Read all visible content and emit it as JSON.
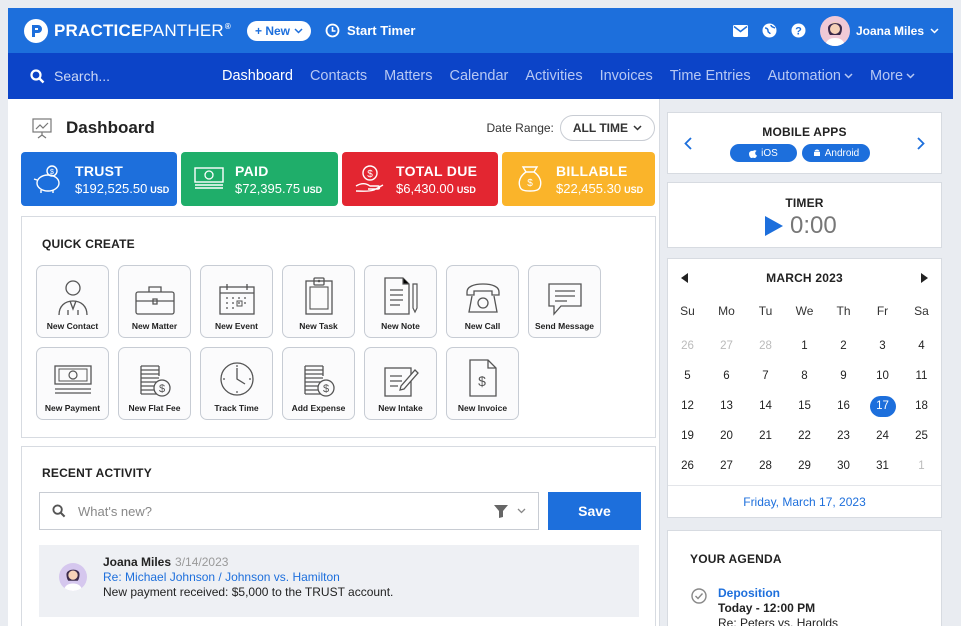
{
  "brand": {
    "name_bold": "PRACTICE",
    "name_thin": "PANTHER",
    "reg": "®"
  },
  "header": {
    "new_button": "+ New",
    "start_timer": "Start Timer",
    "user_name": "Joana Miles",
    "icons": [
      "mail-icon",
      "globe-icon",
      "help-icon",
      "avatar"
    ]
  },
  "nav": {
    "search_placeholder": "Search...",
    "items": [
      {
        "label": "Dashboard",
        "active": true
      },
      {
        "label": "Contacts"
      },
      {
        "label": "Matters"
      },
      {
        "label": "Calendar"
      },
      {
        "label": "Activities"
      },
      {
        "label": "Invoices"
      },
      {
        "label": "Time Entries"
      },
      {
        "label": "Automation",
        "dropdown": true
      },
      {
        "label": "More",
        "dropdown": true
      }
    ]
  },
  "dashboard": {
    "title": "Dashboard",
    "date_range_label": "Date Range:",
    "date_range_value": "ALL TIME"
  },
  "stats": [
    {
      "label": "TRUST",
      "value": "$192,525.50",
      "currency": "USD",
      "color": "#1d6fdc"
    },
    {
      "label": "PAID",
      "value": "$72,395.75",
      "currency": "USD",
      "color": "#1fae6a"
    },
    {
      "label": "TOTAL DUE",
      "value": "$6,430.00",
      "currency": "USD",
      "color": "#e32631"
    },
    {
      "label": "BILLABLE",
      "value": "$22,455.30",
      "currency": "USD",
      "color": "#fab42a"
    }
  ],
  "quick_create": {
    "title": "QUICK CREATE",
    "items": [
      {
        "label": "New Contact",
        "icon": "contact-icon"
      },
      {
        "label": "New Matter",
        "icon": "briefcase-icon"
      },
      {
        "label": "New Event",
        "icon": "calendar-icon"
      },
      {
        "label": "New Task",
        "icon": "clipboard-icon"
      },
      {
        "label": "New Note",
        "icon": "note-icon"
      },
      {
        "label": "New Call",
        "icon": "phone-icon"
      },
      {
        "label": "Send Message",
        "icon": "message-icon"
      },
      {
        "label": "New Payment",
        "icon": "payment-icon"
      },
      {
        "label": "New Flat Fee",
        "icon": "coins-icon"
      },
      {
        "label": "Track Time",
        "icon": "clock-icon"
      },
      {
        "label": "Add Expense",
        "icon": "expense-icon"
      },
      {
        "label": "New Intake",
        "icon": "intake-icon"
      },
      {
        "label": "New Invoice",
        "icon": "invoice-icon"
      }
    ]
  },
  "recent_activity": {
    "title": "RECENT ACTIVITY",
    "placeholder": "What's new?",
    "save_label": "Save",
    "items": [
      {
        "name": "Joana Miles",
        "date": "3/14/2023",
        "re_prefix": "Re:",
        "re_link": "Michael Johnson / Johnson vs. Hamilton",
        "message": "New payment received: $5,000 to the TRUST account."
      }
    ]
  },
  "mobile_apps": {
    "title": "MOBILE APPS",
    "ios": "iOS",
    "android": "Android"
  },
  "timer": {
    "title": "TIMER",
    "value": "0:00"
  },
  "calendar": {
    "month": "MARCH 2023",
    "days_of_week": [
      "Su",
      "Mo",
      "Tu",
      "We",
      "Th",
      "Fr",
      "Sa"
    ],
    "weeks": [
      [
        [
          "26",
          true
        ],
        [
          "27",
          true
        ],
        [
          "28",
          true
        ],
        [
          "1"
        ],
        [
          "2"
        ],
        [
          "3"
        ],
        [
          "4"
        ]
      ],
      [
        [
          "5"
        ],
        [
          "6"
        ],
        [
          "7"
        ],
        [
          "8"
        ],
        [
          "9"
        ],
        [
          "10"
        ],
        [
          "11"
        ]
      ],
      [
        [
          "12"
        ],
        [
          "13"
        ],
        [
          "14"
        ],
        [
          "15"
        ],
        [
          "16"
        ],
        [
          "17",
          false,
          true
        ],
        [
          "18"
        ]
      ],
      [
        [
          "19"
        ],
        [
          "20"
        ],
        [
          "21"
        ],
        [
          "22"
        ],
        [
          "23"
        ],
        [
          "24"
        ],
        [
          "25"
        ]
      ],
      [
        [
          "26"
        ],
        [
          "27"
        ],
        [
          "28"
        ],
        [
          "29"
        ],
        [
          "30"
        ],
        [
          "31"
        ],
        [
          "1",
          true
        ]
      ]
    ],
    "selected_text": "Friday, March 17, 2023"
  },
  "agenda": {
    "title": "YOUR AGENDA",
    "items": [
      {
        "title": "Deposition",
        "time": "Today - 12:00 PM",
        "re": "Re: Peters vs. Harolds"
      }
    ]
  }
}
